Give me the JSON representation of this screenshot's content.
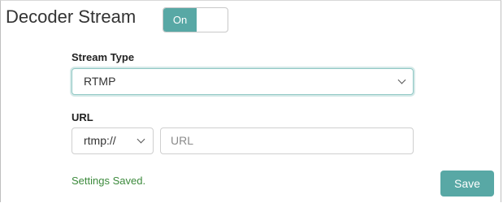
{
  "header": {
    "title": "Decoder Stream",
    "toggle_label": "On",
    "toggle_state": "on"
  },
  "stream_type": {
    "label": "Stream Type",
    "selected": "RTMP"
  },
  "url": {
    "label": "URL",
    "protocol_selected": "rtmp://",
    "placeholder": "URL",
    "value": ""
  },
  "footer": {
    "status": "Settings Saved.",
    "save_label": "Save"
  },
  "colors": {
    "accent": "#58a8a5",
    "status_text": "#3c8a3c"
  },
  "icons": {
    "select_arrow": "chevron-down-icon"
  }
}
